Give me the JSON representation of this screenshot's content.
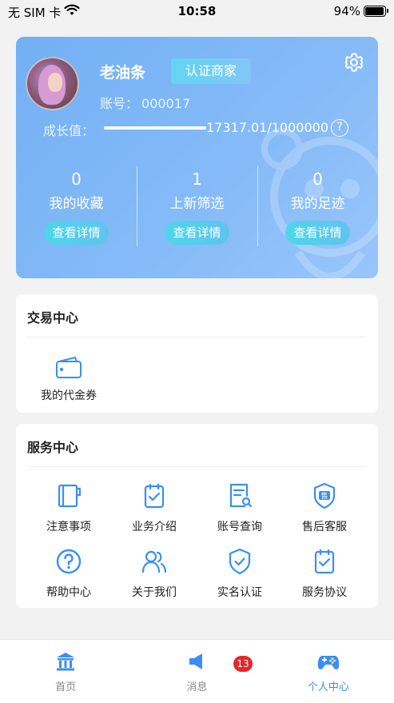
{
  "status_bar": {
    "carrier": "无 SIM 卡",
    "time": "10:58",
    "battery": "94%"
  },
  "profile": {
    "nickname": "老油条",
    "merchant_badge": "认证商家",
    "account_label": "账号：",
    "account_number": "000017",
    "growth_label": "成长值：",
    "growth_value": "17317.01/1000000",
    "growth_fraction": 0.0173,
    "stats": [
      {
        "count": "0",
        "label": "我的收藏",
        "button": "查看详情"
      },
      {
        "count": "1",
        "label": "上新筛选",
        "button": "查看详情"
      },
      {
        "count": "0",
        "label": "我的足迹",
        "button": "查看详情"
      }
    ]
  },
  "trade_center": {
    "title": "交易中心",
    "items": [
      {
        "label": "我的代金券",
        "icon": "wallet-icon"
      }
    ]
  },
  "service_center": {
    "title": "服务中心",
    "items": [
      {
        "label": "注意事项",
        "icon": "notebook-icon"
      },
      {
        "label": "业务介绍",
        "icon": "clipboard-check-icon"
      },
      {
        "label": "账号查询",
        "icon": "document-search-icon"
      },
      {
        "label": "售后客服",
        "icon": "shield-badge-icon"
      },
      {
        "label": "帮助中心",
        "icon": "question-circle-icon"
      },
      {
        "label": "关于我们",
        "icon": "users-icon"
      },
      {
        "label": "实名认证",
        "icon": "shield-check-icon"
      },
      {
        "label": "服务协议",
        "icon": "agreement-icon"
      }
    ]
  },
  "tab_bar": {
    "tabs": [
      {
        "label": "首页",
        "icon": "home-icon"
      },
      {
        "label": "消息",
        "icon": "megaphone-icon",
        "badge": "13"
      },
      {
        "label": "个人中心",
        "icon": "gamepad-icon",
        "active": true
      }
    ]
  },
  "colors": {
    "accent": "#3a8ef6",
    "card_gradient_start": "#72b0f4",
    "badge_red": "#e8262c",
    "teal_button": "#4fd6e9"
  }
}
